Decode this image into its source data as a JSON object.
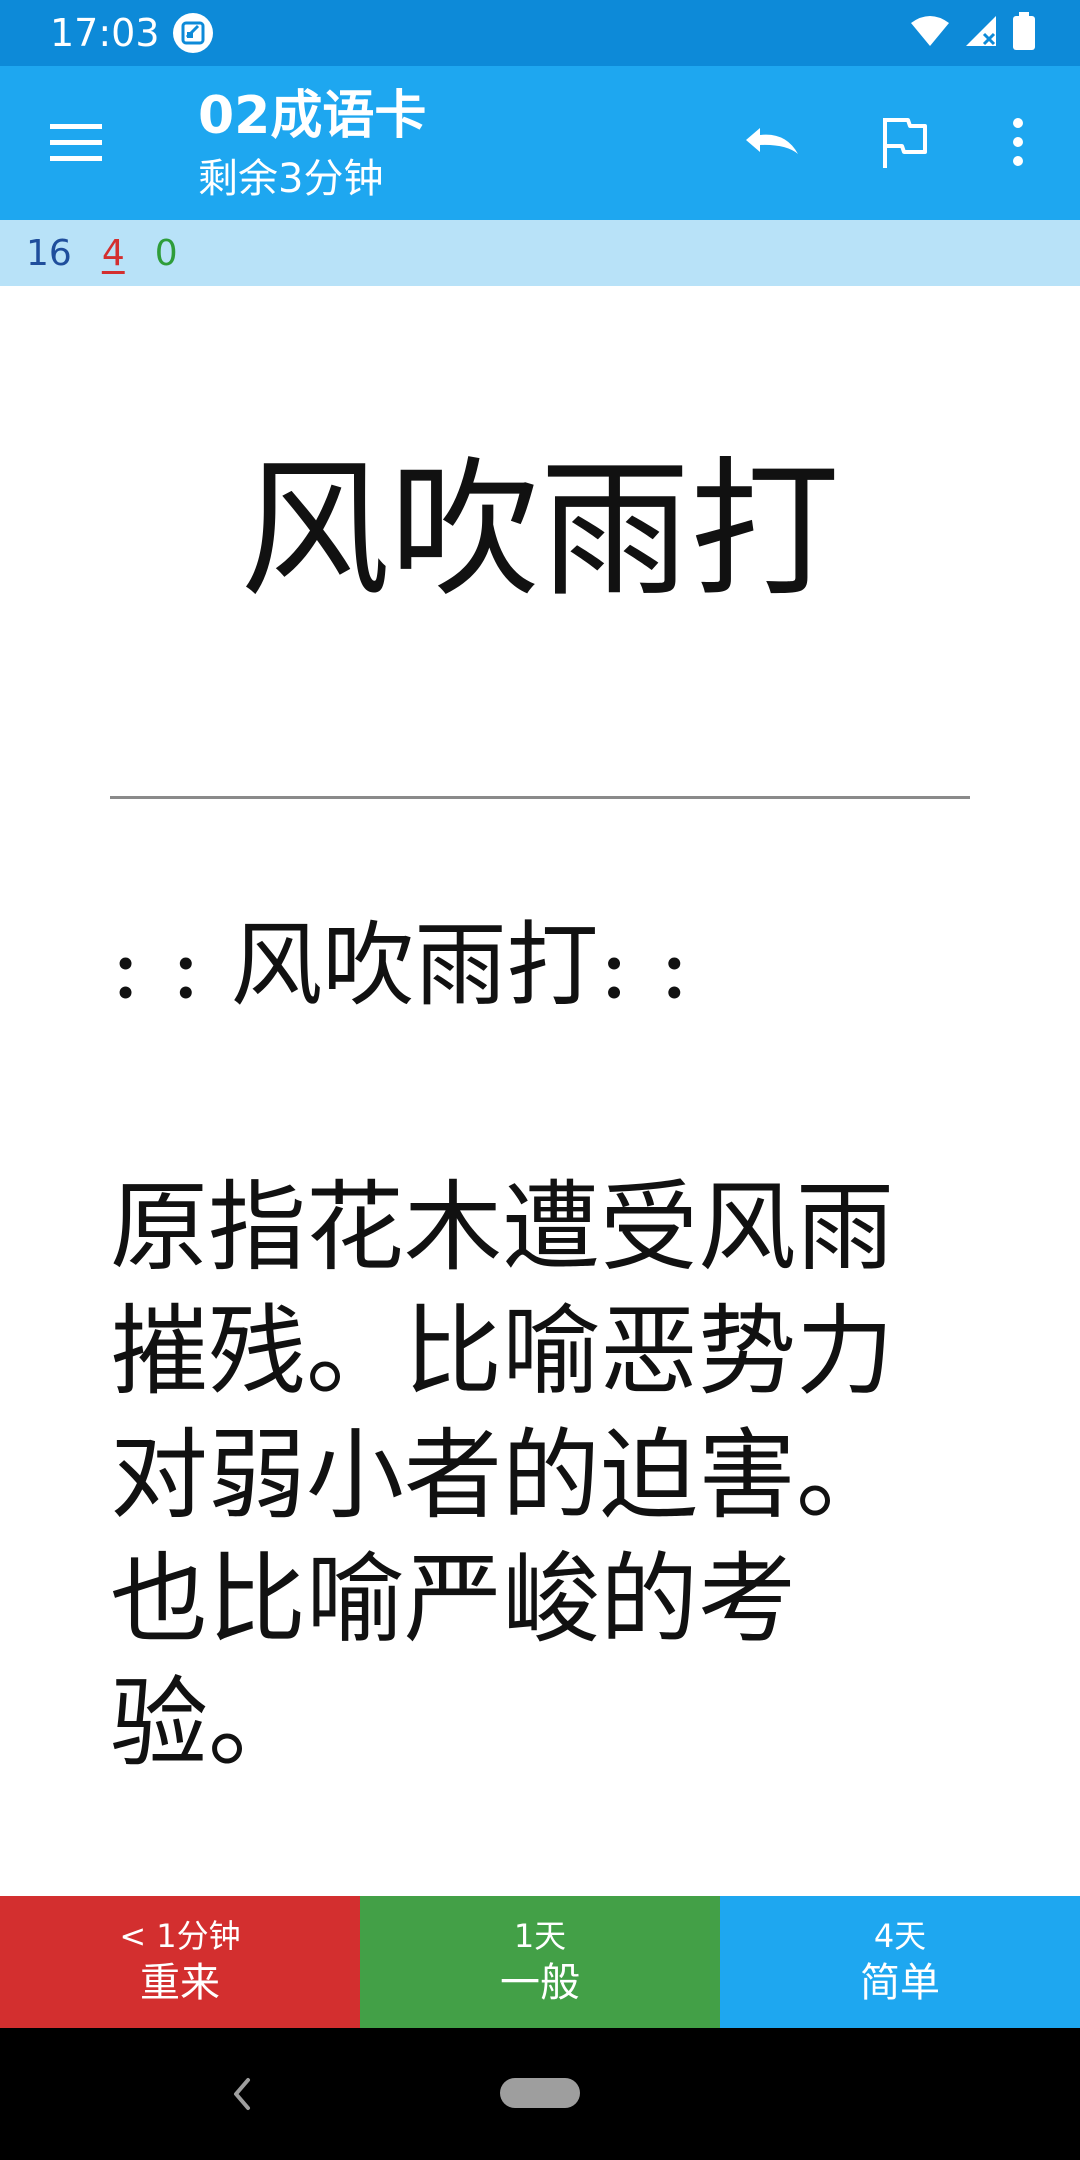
{
  "status_bar": {
    "time": "17:03",
    "icons": [
      "app-notification-icon",
      "wifi-icon",
      "cell-signal-icon",
      "battery-icon"
    ]
  },
  "app_bar": {
    "title": "02成语卡",
    "subtitle": "剩余3分钟",
    "icons": [
      "menu-icon",
      "undo-icon",
      "flag-icon",
      "more-vert-icon"
    ]
  },
  "counts": {
    "new": "16",
    "learning": "4",
    "review": "0"
  },
  "card": {
    "question": "风吹雨打",
    "answer_word": ": : 风吹雨打: :",
    "answer_definition": "原指花木遭受风雨摧残。比喻恶势力对弱小者的迫害。也比喻严峻的考验。"
  },
  "answer_buttons": [
    {
      "interval": "< 1分钟",
      "label": "重来",
      "color": "#d32f2f"
    },
    {
      "interval": "1天",
      "label": "一般",
      "color": "#43a047"
    },
    {
      "interval": "4天",
      "label": "简单",
      "color": "#1ea7f0"
    }
  ],
  "colors": {
    "status_bar": "#0d8ad8",
    "app_bar": "#1ea7f0",
    "counts_bar": "#b8e2f8",
    "count_new": "#1f4e9c",
    "count_learning": "#d32f2f",
    "count_review": "#2e9d3a"
  }
}
